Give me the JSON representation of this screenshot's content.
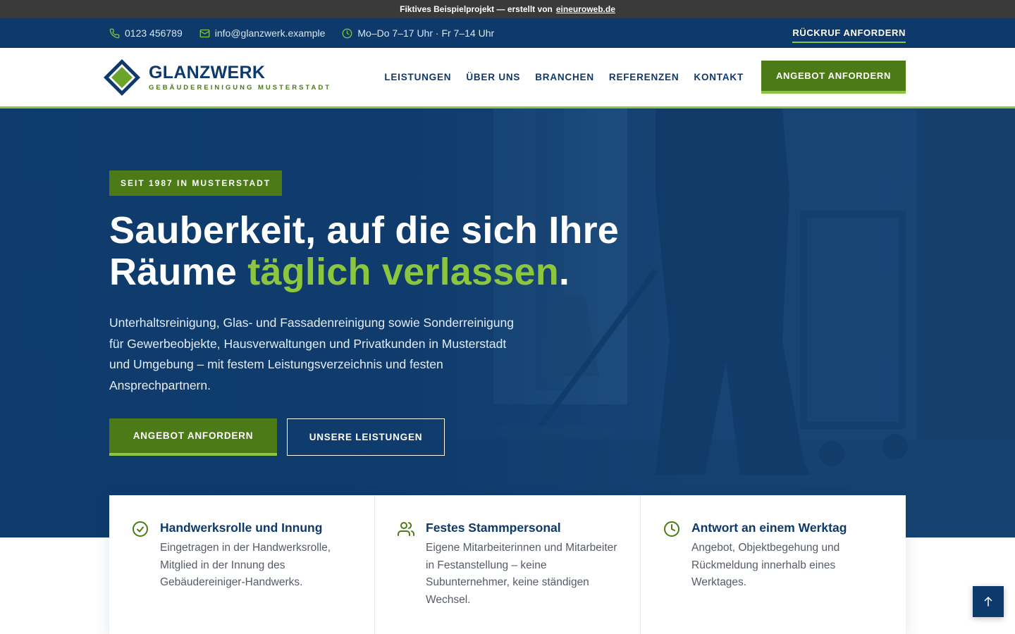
{
  "demo_bar": {
    "text": "Fiktives Beispielprojekt — erstellt von",
    "link": "eineuroweb.de"
  },
  "topbar": {
    "phone": "0123 456789",
    "email": "info@glanzwerk.example",
    "hours": "Mo–Do 7–17 Uhr · Fr 7–14 Uhr",
    "callback": "RÜCKRUF ANFORDERN"
  },
  "header": {
    "logo_name": "GLANZWERK",
    "logo_sub": "GEBÄUDEREINIGUNG MUSTERSTADT",
    "nav": [
      "LEISTUNGEN",
      "ÜBER UNS",
      "BRANCHEN",
      "REFERENZEN",
      "KONTAKT"
    ],
    "cta": "ANGEBOT ANFORDERN"
  },
  "hero": {
    "badge": "SEIT 1987 IN MUSTERSTADT",
    "title_line1": "Sauberkeit, auf die sich Ihre",
    "title_line2_start": "Räume ",
    "title_highlight": "täglich verlassen",
    "title_end": ".",
    "description": "Unterhaltsreinigung, Glas- und Fassadenreinigung sowie Sonderreinigung für Gewerbeobjekte, Hausverwaltungen und Privatkunden in Musterstadt und Umgebung – mit festem Leistungsverzeichnis und festen Ansprechpartnern.",
    "btn_primary": "ANGEBOT ANFORDERN",
    "btn_secondary": "UNSERE LEISTUNGEN"
  },
  "features": [
    {
      "icon": "check-circle-icon",
      "title": "Handwerksrolle und Innung",
      "text": "Eingetragen in der Handwerksrolle, Mitglied in der Innung des Gebäudereiniger-Handwerks."
    },
    {
      "icon": "users-icon",
      "title": "Festes Stammpersonal",
      "text": "Eigene Mitarbeiterinnen und Mitarbeiter in Festanstellung – keine Subunternehmer, keine ständigen Wechsel."
    },
    {
      "icon": "clock-icon",
      "title": "Antwort an einem Werktag",
      "text": "Angebot, Objektbegehung und Rückmeldung innerhalb eines Werktages."
    }
  ],
  "colors": {
    "navy": "#0d3a6b",
    "green": "#4b7a16",
    "lime": "#8cc63f"
  }
}
